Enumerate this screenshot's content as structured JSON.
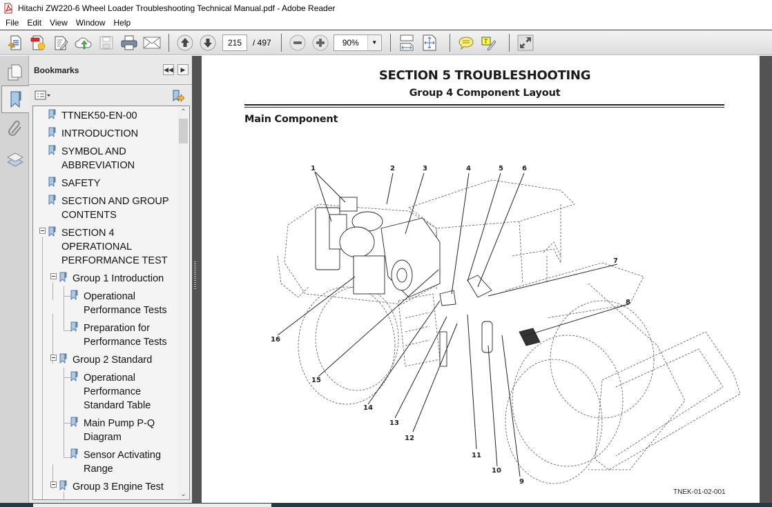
{
  "window": {
    "title": "Hitachi ZW220-6 Wheel Loader Troubleshooting Technical Manual.pdf - Adobe Reader",
    "icon": "pdf-file-icon"
  },
  "menu": {
    "items": [
      "File",
      "Edit",
      "View",
      "Window",
      "Help"
    ]
  },
  "toolbar": {
    "buttons": [
      {
        "name": "create-pdf-button",
        "icon": "create-pdf-icon"
      },
      {
        "name": "export-pdf-button",
        "icon": "export-pdf-icon"
      },
      {
        "name": "edit-pdf-button",
        "icon": "edit-icon"
      },
      {
        "name": "upload-cloud-button",
        "icon": "cloud-upload-icon"
      },
      {
        "name": "save-button",
        "icon": "save-icon",
        "disabled": true
      },
      {
        "name": "print-button",
        "icon": "print-icon"
      },
      {
        "name": "email-button",
        "icon": "email-icon"
      },
      {
        "name": "previous-page-button",
        "icon": "arrow-up-icon"
      },
      {
        "name": "next-page-button",
        "icon": "arrow-down-icon"
      },
      {
        "name": "zoom-out-button",
        "icon": "minus-icon"
      },
      {
        "name": "zoom-in-button",
        "icon": "plus-icon"
      },
      {
        "name": "scrolling-mode-button",
        "icon": "scroll-mode-icon"
      },
      {
        "name": "fit-page-button",
        "icon": "fit-page-icon"
      },
      {
        "name": "comment-button",
        "icon": "speech-bubble-icon"
      },
      {
        "name": "highlight-text-button",
        "icon": "highlight-text-icon"
      },
      {
        "name": "full-screen-button",
        "icon": "expand-icon"
      }
    ],
    "current_page": "215",
    "total_pages": "/ 497",
    "zoom_level": "90%"
  },
  "nav_panel": {
    "buttons": [
      {
        "name": "page-thumbnails-button",
        "icon": "pages-icon"
      },
      {
        "name": "bookmarks-button",
        "icon": "bookmark-icon",
        "active": true
      },
      {
        "name": "attachments-button",
        "icon": "paperclip-icon"
      },
      {
        "name": "layers-button",
        "icon": "layers-icon"
      }
    ]
  },
  "bookmarks": {
    "title": "Bookmarks",
    "items": [
      {
        "label": "TTNEK50-EN-00",
        "level": 0
      },
      {
        "label": "INTRODUCTION",
        "level": 0
      },
      {
        "label": "SYMBOL AND\nABBREVIATION",
        "level": 0
      },
      {
        "label": "SAFETY",
        "level": 0
      },
      {
        "label": "SECTION AND GROUP\nCONTENTS",
        "level": 0
      },
      {
        "label": "SECTION 4\nOPERATIONAL\nPERFORMANCE TEST",
        "level": 0,
        "expanded": true
      },
      {
        "label": "Group 1 Introduction",
        "level": 1,
        "expanded": true
      },
      {
        "label": "Operational\nPerformance Tests",
        "level": 2
      },
      {
        "label": "Preparation for\nPerformance Tests",
        "level": 2
      },
      {
        "label": "Group 2 Standard",
        "level": 1,
        "expanded": true
      },
      {
        "label": "Operational\nPerformance\nStandard Table",
        "level": 2
      },
      {
        "label": "Main Pump P-Q\nDiagram",
        "level": 2
      },
      {
        "label": "Sensor Activating\nRange",
        "level": 2
      },
      {
        "label": "Group 3 Engine Test",
        "level": 1,
        "expanded": true
      }
    ]
  },
  "document": {
    "section_title": "SECTION 5 TROUBLESHOOTING",
    "group_title": "Group 4 Component Layout",
    "subheading": "Main Component",
    "figure_code": "TNEK-01-02-001",
    "callouts": [
      "1",
      "2",
      "3",
      "4",
      "5",
      "6",
      "7",
      "8",
      "9",
      "10",
      "11",
      "12",
      "13",
      "14",
      "15",
      "16"
    ]
  }
}
